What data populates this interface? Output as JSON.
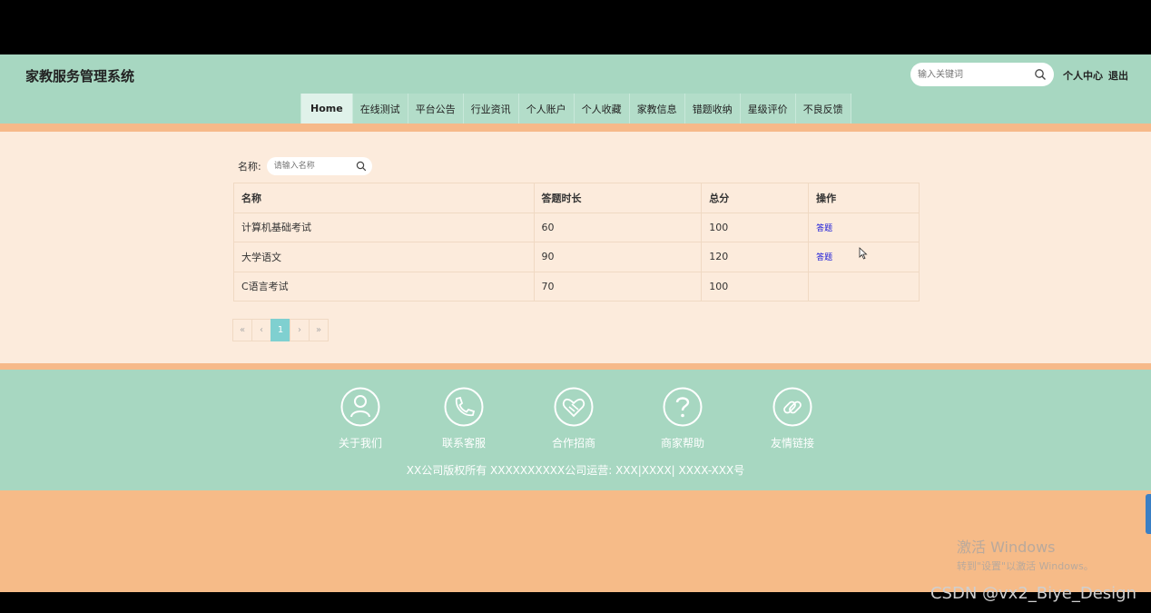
{
  "app": {
    "title": "家教服务管理系统"
  },
  "header": {
    "search_placeholder": "输入关键词",
    "user_center": "个人中心",
    "logout": "退出"
  },
  "nav": {
    "items": [
      "Home",
      "在线测试",
      "平台公告",
      "行业资讯",
      "个人账户",
      "个人收藏",
      "家教信息",
      "错题收纳",
      "星级评价",
      "不良反馈"
    ],
    "active": "Home"
  },
  "filter": {
    "label": "名称:",
    "placeholder": "请输入名称"
  },
  "table": {
    "columns": [
      "名称",
      "答题时长",
      "总分",
      "操作"
    ],
    "rows": [
      {
        "name": "计算机基础考试",
        "duration": "60",
        "score": "100",
        "action": "答题"
      },
      {
        "name": "大学语文",
        "duration": "90",
        "score": "120",
        "action": "答题"
      },
      {
        "name": "C语言考试",
        "duration": "70",
        "score": "100",
        "action": ""
      }
    ]
  },
  "pager": {
    "first": "«",
    "prev": "‹",
    "current": "1",
    "next": "›",
    "last": "»"
  },
  "footer": {
    "links": [
      {
        "label": "关于我们",
        "icon": "person-icon"
      },
      {
        "label": "联系客服",
        "icon": "phone-icon"
      },
      {
        "label": "合作招商",
        "icon": "handshake-icon"
      },
      {
        "label": "商家帮助",
        "icon": "question-icon"
      },
      {
        "label": "友情链接",
        "icon": "link-icon"
      }
    ],
    "copyright": "XX公司版权所有 XXXXXXXXXX公司运营: XXX|XXXX| XXXX-XXX号"
  },
  "overlay": {
    "activate_title": "激活 Windows",
    "activate_sub": "转到\"设置\"以激活 Windows。",
    "watermark": "CSDN @vx2_Biye_Design"
  },
  "colors": {
    "header_bg": "#a7d7c1",
    "stripe": "#f6b989",
    "main_bg": "#fcebdc",
    "pager_active": "#7fd0d0",
    "link": "#1a1ad9"
  }
}
